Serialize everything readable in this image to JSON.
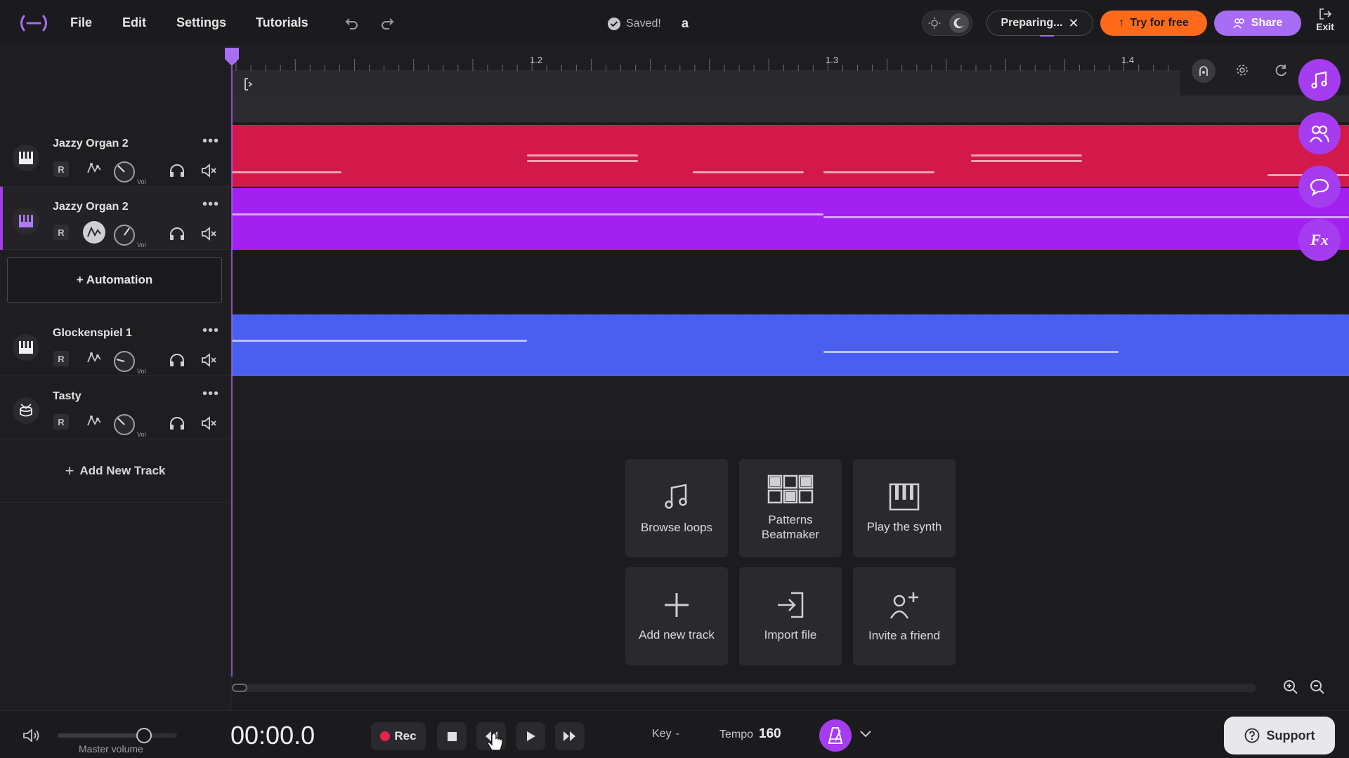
{
  "app": {
    "logo": "daw-logo-icon"
  },
  "menu": [
    {
      "label": "File"
    },
    {
      "label": "Edit"
    },
    {
      "label": "Settings"
    },
    {
      "label": "Tutorials"
    }
  ],
  "header": {
    "saved_status": "Saved!",
    "project_name": "a",
    "preparing_label": "Preparing...",
    "try_label": "Try for free",
    "share_label": "Share",
    "exit_label": "Exit"
  },
  "ruler": {
    "markers": [
      "1.2",
      "1.3",
      "1.4"
    ]
  },
  "tracks": [
    {
      "name": "Jazzy Organ 2",
      "record_label": "R",
      "vol_label": "Vol",
      "color": "#d2194a",
      "icon": "piano-icon",
      "selected": false
    },
    {
      "name": "Jazzy Organ 2",
      "record_label": "R",
      "vol_label": "Vol",
      "color": "#a220f0",
      "icon": "piano-icon",
      "selected": true
    },
    {
      "name": "Glockenspiel 1",
      "record_label": "R",
      "vol_label": "Vol",
      "color": "#4a5ff0",
      "icon": "piano-icon",
      "selected": false
    },
    {
      "name": "Tasty",
      "record_label": "R",
      "vol_label": "Vol",
      "color": "#2a2a2e",
      "icon": "drum-icon",
      "selected": false
    }
  ],
  "automation_label": "+ Automation",
  "add_track_label": "Add New Track",
  "quick_actions": [
    {
      "label": "Browse loops",
      "icon": "music-note-icon"
    },
    {
      "label": "Patterns Beatmaker",
      "icon": "grid-pads-icon"
    },
    {
      "label": "Play the synth",
      "icon": "piano-keys-icon"
    },
    {
      "label": "Add new track",
      "icon": "plus-icon"
    },
    {
      "label": "Import file",
      "icon": "import-icon"
    },
    {
      "label": "Invite a friend",
      "icon": "add-user-icon"
    }
  ],
  "side_tools": [
    "instrument-icon",
    "collaborators-icon",
    "chat-icon",
    "fx-icon"
  ],
  "side_fx_label": "Fx",
  "transport": {
    "master_volume_label": "Master volume",
    "time": "00:00.0",
    "rec_label": "Rec",
    "key_label": "Key",
    "key_value": "-",
    "tempo_label": "Tempo",
    "tempo_value": "160",
    "support_label": "Support"
  },
  "colors": {
    "accent": "#a53cf0",
    "orange": "#ff6a1a",
    "red_track": "#d2194a",
    "purple_track": "#a220f0",
    "blue_track": "#4a5ff0"
  }
}
